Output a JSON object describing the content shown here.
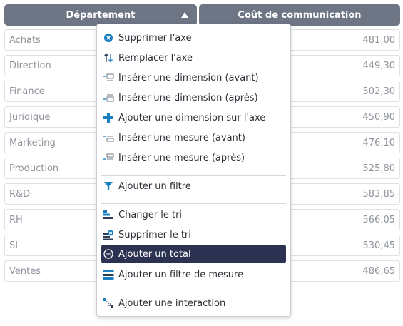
{
  "table": {
    "headers": {
      "department": "Département",
      "cost": "Coût de communication"
    },
    "rows": [
      {
        "department": "Achats",
        "cost": "481,00"
      },
      {
        "department": "Direction",
        "cost": "449,30"
      },
      {
        "department": "Finance",
        "cost": "502,30"
      },
      {
        "department": "Juridique",
        "cost": "450,90"
      },
      {
        "department": "Marketing",
        "cost": "476,10"
      },
      {
        "department": "Production",
        "cost": "525,80"
      },
      {
        "department": "R&D",
        "cost": "583,85"
      },
      {
        "department": "RH",
        "cost": "566,05"
      },
      {
        "department": "SI",
        "cost": "530,45"
      },
      {
        "department": "Ventes",
        "cost": "486,65"
      }
    ]
  },
  "context_menu": {
    "items": [
      {
        "label": "Supprimer l'axe",
        "icon": "remove-circle-icon"
      },
      {
        "label": "Remplacer l'axe",
        "icon": "swap-vertical-icon"
      },
      {
        "label": "Insérer une dimension (avant)",
        "icon": "insert-before-icon"
      },
      {
        "label": "Insérer une dimension (après)",
        "icon": "insert-after-icon"
      },
      {
        "label": "Ajouter une dimension sur l'axe",
        "icon": "plus-icon"
      },
      {
        "label": "Insérer une mesure (avant)",
        "icon": "insert-before-icon"
      },
      {
        "label": "Insérer une mesure (après)",
        "icon": "insert-after-icon"
      },
      {
        "label": "Ajouter un filtre",
        "icon": "filter-icon"
      },
      {
        "label": "Changer le tri",
        "icon": "sort-icon"
      },
      {
        "label": "Supprimer le tri",
        "icon": "remove-sort-icon"
      },
      {
        "label": "Ajouter un total",
        "icon": "total-icon",
        "active": true
      },
      {
        "label": "Ajouter un filtre de mesure",
        "icon": "measure-filter-icon"
      },
      {
        "label": "Ajouter une interaction",
        "icon": "interaction-icon"
      }
    ]
  },
  "colors": {
    "header_bg": "#6e7686",
    "menu_active_bg": "#2b3252",
    "icon_accent": "#1a7fc1"
  }
}
